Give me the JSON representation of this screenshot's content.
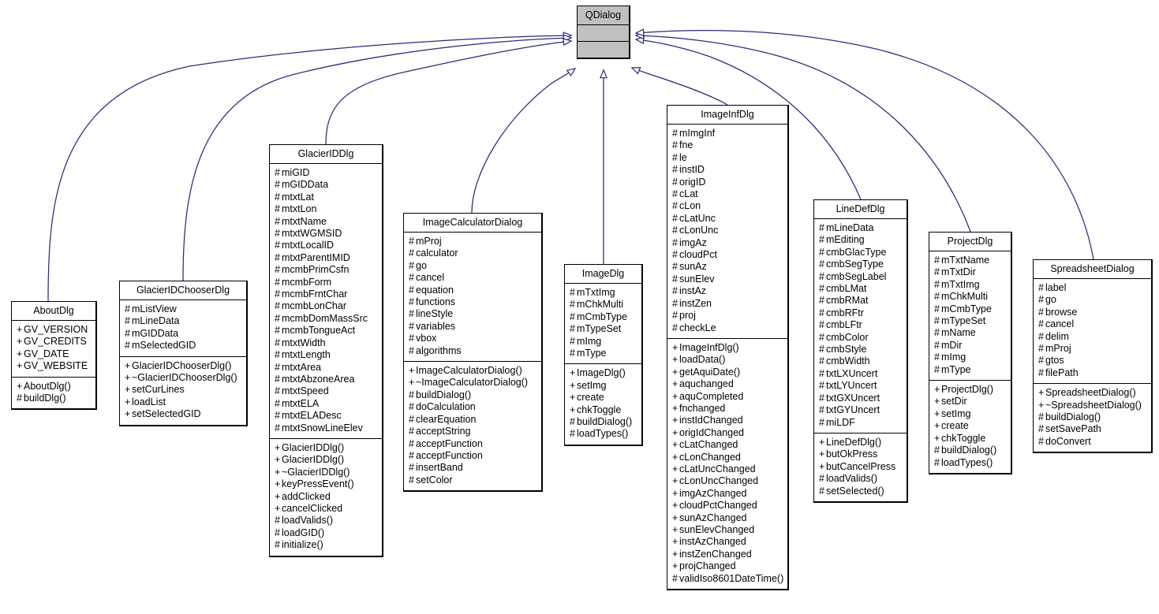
{
  "diagram": {
    "kind": "uml-class-inheritance-diagram",
    "edge_color": "#2b2b7c",
    "root_fill": "#c0c0c0",
    "box_fill": "#ffffff",
    "border_color": "#000000",
    "arrow_style": "hollow-triangle-generalization"
  },
  "classes": {
    "qdialog": {
      "name": "QDialog",
      "attributes": [],
      "operations": []
    },
    "aboutdlg": {
      "name": "AboutDlg",
      "attributes": [
        {
          "vis": "+",
          "text": "GV_VERSION"
        },
        {
          "vis": "+",
          "text": "GV_CREDITS"
        },
        {
          "vis": "+",
          "text": "GV_DATE"
        },
        {
          "vis": "+",
          "text": "GV_WEBSITE"
        }
      ],
      "operations": [
        {
          "vis": "+",
          "text": "AboutDlg()"
        },
        {
          "vis": "#",
          "text": "buildDlg()"
        }
      ]
    },
    "glacieridchooserdlg": {
      "name": "GlacierIDChooserDlg",
      "attributes": [
        {
          "vis": "#",
          "text": "mListView"
        },
        {
          "vis": "#",
          "text": "mLineData"
        },
        {
          "vis": "#",
          "text": "mGIDData"
        },
        {
          "vis": "#",
          "text": "mSelectedGID"
        }
      ],
      "operations": [
        {
          "vis": "+",
          "text": "GlacierIDChooserDlg()"
        },
        {
          "vis": "+",
          "text": "~GlacierIDChooserDlg()"
        },
        {
          "vis": "+",
          "text": "setCurLines"
        },
        {
          "vis": "+",
          "text": "loadList"
        },
        {
          "vis": "+",
          "text": "setSelectedGID"
        }
      ]
    },
    "glacieriddlg": {
      "name": "GlacierIDDlg",
      "attributes": [
        {
          "vis": "#",
          "text": "miGID"
        },
        {
          "vis": "#",
          "text": "mGIDData"
        },
        {
          "vis": "#",
          "text": "mtxtLat"
        },
        {
          "vis": "#",
          "text": "mtxtLon"
        },
        {
          "vis": "#",
          "text": "mtxtName"
        },
        {
          "vis": "#",
          "text": "mtxtWGMSID"
        },
        {
          "vis": "#",
          "text": "mtxtLocalID"
        },
        {
          "vis": "#",
          "text": "mtxtParentIMID"
        },
        {
          "vis": "#",
          "text": "mcmbPrimCsfn"
        },
        {
          "vis": "#",
          "text": "mcmbForm"
        },
        {
          "vis": "#",
          "text": "mcmbFrntChar"
        },
        {
          "vis": "#",
          "text": "mcmbLonChar"
        },
        {
          "vis": "#",
          "text": "mcmbDomMassSrc"
        },
        {
          "vis": "#",
          "text": "mcmbTongueAct"
        },
        {
          "vis": "#",
          "text": "mtxtWidth"
        },
        {
          "vis": "#",
          "text": "mtxtLength"
        },
        {
          "vis": "#",
          "text": "mtxtArea"
        },
        {
          "vis": "#",
          "text": "mtxtAbzoneArea"
        },
        {
          "vis": "#",
          "text": "mtxtSpeed"
        },
        {
          "vis": "#",
          "text": "mtxtELA"
        },
        {
          "vis": "#",
          "text": "mtxtELADesc"
        },
        {
          "vis": "#",
          "text": "mtxtSnowLineElev"
        }
      ],
      "operations": [
        {
          "vis": "+",
          "text": "GlacierIDDlg()"
        },
        {
          "vis": "+",
          "text": "GlacierIDDlg()"
        },
        {
          "vis": "+",
          "text": "~GlacierIDDlg()"
        },
        {
          "vis": "+",
          "text": "keyPressEvent()"
        },
        {
          "vis": "+",
          "text": "addClicked"
        },
        {
          "vis": "+",
          "text": "cancelClicked"
        },
        {
          "vis": "#",
          "text": "loadValids()"
        },
        {
          "vis": "#",
          "text": "loadGID()"
        },
        {
          "vis": "#",
          "text": "initialize()"
        }
      ]
    },
    "imagecalculatordialog": {
      "name": "ImageCalculatorDialog",
      "attributes": [
        {
          "vis": "#",
          "text": "mProj"
        },
        {
          "vis": "#",
          "text": "calculator"
        },
        {
          "vis": "#",
          "text": "go"
        },
        {
          "vis": "#",
          "text": "cancel"
        },
        {
          "vis": "#",
          "text": "equation"
        },
        {
          "vis": "#",
          "text": "functions"
        },
        {
          "vis": "#",
          "text": "lineStyle"
        },
        {
          "vis": "#",
          "text": "variables"
        },
        {
          "vis": "#",
          "text": "vbox"
        },
        {
          "vis": "#",
          "text": "algorithms"
        }
      ],
      "operations": [
        {
          "vis": "+",
          "text": "ImageCalculatorDialog()"
        },
        {
          "vis": "+",
          "text": "~ImageCalculatorDialog()"
        },
        {
          "vis": "#",
          "text": "buildDialog()"
        },
        {
          "vis": "#",
          "text": "doCalculation"
        },
        {
          "vis": "#",
          "text": "clearEquation"
        },
        {
          "vis": "#",
          "text": "acceptString"
        },
        {
          "vis": "#",
          "text": "acceptFunction"
        },
        {
          "vis": "#",
          "text": "acceptFunction"
        },
        {
          "vis": "#",
          "text": "insertBand"
        },
        {
          "vis": "#",
          "text": "setColor"
        }
      ]
    },
    "imagedlg": {
      "name": "ImageDlg",
      "attributes": [
        {
          "vis": "#",
          "text": "mTxtImg"
        },
        {
          "vis": "#",
          "text": "mChkMulti"
        },
        {
          "vis": "#",
          "text": "mCmbType"
        },
        {
          "vis": "#",
          "text": "mTypeSet"
        },
        {
          "vis": "#",
          "text": "mImg"
        },
        {
          "vis": "#",
          "text": "mType"
        }
      ],
      "operations": [
        {
          "vis": "+",
          "text": "ImageDlg()"
        },
        {
          "vis": "+",
          "text": "setImg"
        },
        {
          "vis": "+",
          "text": "create"
        },
        {
          "vis": "+",
          "text": "chkToggle"
        },
        {
          "vis": "#",
          "text": "buildDialog()"
        },
        {
          "vis": "#",
          "text": "loadTypes()"
        }
      ]
    },
    "imageinfdlg": {
      "name": "ImageInfDlg",
      "attributes": [
        {
          "vis": "#",
          "text": "mImgInf"
        },
        {
          "vis": "#",
          "text": "fne"
        },
        {
          "vis": "#",
          "text": "le"
        },
        {
          "vis": "#",
          "text": "instID"
        },
        {
          "vis": "#",
          "text": "origID"
        },
        {
          "vis": "#",
          "text": "cLat"
        },
        {
          "vis": "#",
          "text": "cLon"
        },
        {
          "vis": "#",
          "text": "cLatUnc"
        },
        {
          "vis": "#",
          "text": "cLonUnc"
        },
        {
          "vis": "#",
          "text": "imgAz"
        },
        {
          "vis": "#",
          "text": "cloudPct"
        },
        {
          "vis": "#",
          "text": "sunAz"
        },
        {
          "vis": "#",
          "text": "sunElev"
        },
        {
          "vis": "#",
          "text": "instAz"
        },
        {
          "vis": "#",
          "text": "instZen"
        },
        {
          "vis": "#",
          "text": "proj"
        },
        {
          "vis": "#",
          "text": "checkLe"
        }
      ],
      "operations": [
        {
          "vis": "+",
          "text": "ImageInfDlg()"
        },
        {
          "vis": "+",
          "text": "loadData()"
        },
        {
          "vis": "+",
          "text": "getAquiDate()"
        },
        {
          "vis": "+",
          "text": "aquchanged"
        },
        {
          "vis": "+",
          "text": "aquCompleted"
        },
        {
          "vis": "+",
          "text": "fnchanged"
        },
        {
          "vis": "+",
          "text": "instIdChanged"
        },
        {
          "vis": "+",
          "text": "origIdChanged"
        },
        {
          "vis": "+",
          "text": "cLatChanged"
        },
        {
          "vis": "+",
          "text": "cLonChanged"
        },
        {
          "vis": "+",
          "text": "cLatUncChanged"
        },
        {
          "vis": "+",
          "text": "cLonUncChanged"
        },
        {
          "vis": "+",
          "text": "imgAzChanged"
        },
        {
          "vis": "+",
          "text": "cloudPctChanged"
        },
        {
          "vis": "+",
          "text": "sunAzChanged"
        },
        {
          "vis": "+",
          "text": "sunElevChanged"
        },
        {
          "vis": "+",
          "text": "instAzChanged"
        },
        {
          "vis": "+",
          "text": "instZenChanged"
        },
        {
          "vis": "+",
          "text": "projChanged"
        },
        {
          "vis": "#",
          "text": "validIso8601DateTime()"
        }
      ]
    },
    "linedefdlg": {
      "name": "LineDefDlg",
      "attributes": [
        {
          "vis": "#",
          "text": "mLineData"
        },
        {
          "vis": "#",
          "text": "mEditing"
        },
        {
          "vis": "#",
          "text": "cmbGlacType"
        },
        {
          "vis": "#",
          "text": "cmbSegType"
        },
        {
          "vis": "#",
          "text": "cmbSegLabel"
        },
        {
          "vis": "#",
          "text": "cmbLMat"
        },
        {
          "vis": "#",
          "text": "cmbRMat"
        },
        {
          "vis": "#",
          "text": "cmbRFtr"
        },
        {
          "vis": "#",
          "text": "cmbLFtr"
        },
        {
          "vis": "#",
          "text": "cmbColor"
        },
        {
          "vis": "#",
          "text": "cmbStyle"
        },
        {
          "vis": "#",
          "text": "cmbWidth"
        },
        {
          "vis": "#",
          "text": "txtLXUncert"
        },
        {
          "vis": "#",
          "text": "txtLYUncert"
        },
        {
          "vis": "#",
          "text": "txtGXUncert"
        },
        {
          "vis": "#",
          "text": "txtGYUncert"
        },
        {
          "vis": "#",
          "text": "miLDF"
        }
      ],
      "operations": [
        {
          "vis": "+",
          "text": "LineDefDlg()"
        },
        {
          "vis": "+",
          "text": "butOkPress"
        },
        {
          "vis": "+",
          "text": "butCancelPress"
        },
        {
          "vis": "#",
          "text": "loadValids()"
        },
        {
          "vis": "#",
          "text": "setSelected()"
        }
      ]
    },
    "projectdlg": {
      "name": "ProjectDlg",
      "attributes": [
        {
          "vis": "#",
          "text": "mTxtName"
        },
        {
          "vis": "#",
          "text": "mTxtDir"
        },
        {
          "vis": "#",
          "text": "mTxtImg"
        },
        {
          "vis": "#",
          "text": "mChkMulti"
        },
        {
          "vis": "#",
          "text": "mCmbType"
        },
        {
          "vis": "#",
          "text": "mTypeSet"
        },
        {
          "vis": "#",
          "text": "mName"
        },
        {
          "vis": "#",
          "text": "mDir"
        },
        {
          "vis": "#",
          "text": "mImg"
        },
        {
          "vis": "#",
          "text": "mType"
        }
      ],
      "operations": [
        {
          "vis": "+",
          "text": "ProjectDlg()"
        },
        {
          "vis": "+",
          "text": "setDir"
        },
        {
          "vis": "+",
          "text": "setImg"
        },
        {
          "vis": "+",
          "text": "create"
        },
        {
          "vis": "+",
          "text": "chkToggle"
        },
        {
          "vis": "#",
          "text": "buildDialog()"
        },
        {
          "vis": "#",
          "text": "loadTypes()"
        }
      ]
    },
    "spreadsheetdialog": {
      "name": "SpreadsheetDialog",
      "attributes": [
        {
          "vis": "#",
          "text": "label"
        },
        {
          "vis": "#",
          "text": "go"
        },
        {
          "vis": "#",
          "text": "browse"
        },
        {
          "vis": "#",
          "text": "cancel"
        },
        {
          "vis": "#",
          "text": "delim"
        },
        {
          "vis": "#",
          "text": "mProj"
        },
        {
          "vis": "#",
          "text": "gtos"
        },
        {
          "vis": "#",
          "text": "filePath"
        }
      ],
      "operations": [
        {
          "vis": "+",
          "text": "SpreadsheetDialog()"
        },
        {
          "vis": "+",
          "text": "~SpreadsheetDialog()"
        },
        {
          "vis": "#",
          "text": "buildDialog()"
        },
        {
          "vis": "#",
          "text": "setSavePath"
        },
        {
          "vis": "#",
          "text": "doConvert"
        }
      ]
    }
  },
  "inheritance": [
    {
      "from": "AboutDlg",
      "to": "QDialog"
    },
    {
      "from": "GlacierIDChooserDlg",
      "to": "QDialog"
    },
    {
      "from": "GlacierIDDlg",
      "to": "QDialog"
    },
    {
      "from": "ImageCalculatorDialog",
      "to": "QDialog"
    },
    {
      "from": "ImageDlg",
      "to": "QDialog"
    },
    {
      "from": "ImageInfDlg",
      "to": "QDialog"
    },
    {
      "from": "LineDefDlg",
      "to": "QDialog"
    },
    {
      "from": "ProjectDlg",
      "to": "QDialog"
    },
    {
      "from": "SpreadsheetDialog",
      "to": "QDialog"
    }
  ]
}
